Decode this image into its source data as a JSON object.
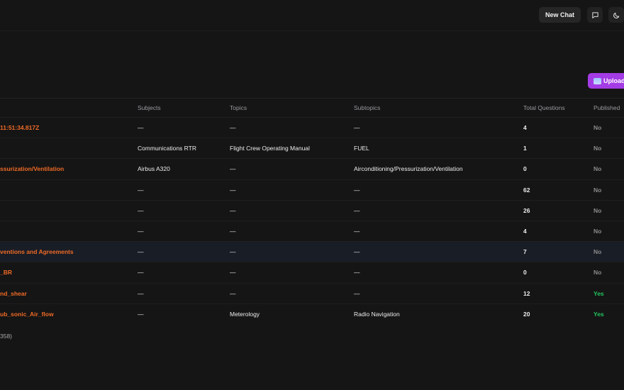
{
  "header": {
    "new_chat_label": "New Chat",
    "icons": [
      "chat-bubble-icon",
      "moon-icon"
    ]
  },
  "toolbar": {
    "upload_label": "Upload"
  },
  "table": {
    "columns": {
      "subjects": "Subjects",
      "topics": "Topics",
      "subtopics": "Subtopics",
      "total": "Total Questions",
      "published": "Published"
    },
    "rows": [
      {
        "name": "11:51:34.817Z",
        "subjects": "—",
        "topics": "—",
        "subtopics": "—",
        "total": "4",
        "published": "No"
      },
      {
        "name": "",
        "subjects": "Communications RTR",
        "topics": "Flight Crew Operating Manual",
        "subtopics": "FUEL",
        "total": "1",
        "published": "No"
      },
      {
        "name": "ssurization/Ventilation",
        "subjects": "Airbus A320",
        "topics": "—",
        "subtopics": "Airconditioning/Pressurization/Ventilation",
        "total": "0",
        "published": "No"
      },
      {
        "name": "",
        "subjects": "—",
        "topics": "—",
        "subtopics": "—",
        "total": "62",
        "published": "No"
      },
      {
        "name": "",
        "subjects": "—",
        "topics": "—",
        "subtopics": "—",
        "total": "26",
        "published": "No"
      },
      {
        "name": "",
        "subjects": "—",
        "topics": "—",
        "subtopics": "—",
        "total": "4",
        "published": "No"
      },
      {
        "name": "ventions and Agreements",
        "subjects": "—",
        "topics": "—",
        "subtopics": "—",
        "total": "7",
        "published": "No"
      },
      {
        "name": "_BR",
        "subjects": "—",
        "topics": "—",
        "subtopics": "—",
        "total": "0",
        "published": "No"
      },
      {
        "name": "nd_shear",
        "subjects": "—",
        "topics": "—",
        "subtopics": "—",
        "total": "12",
        "published": "Yes"
      },
      {
        "name": "ub_sonic_Air_flow",
        "subjects": "—",
        "topics": "Meterology",
        "subtopics": "Radio Navigation",
        "total": "20",
        "published": "Yes"
      }
    ],
    "footer_count": "358)"
  },
  "colors": {
    "accent": "#a43ce6",
    "name_link": "#ef6a26",
    "published_yes": "#22c55e",
    "published_no": "#8a8a8a"
  }
}
